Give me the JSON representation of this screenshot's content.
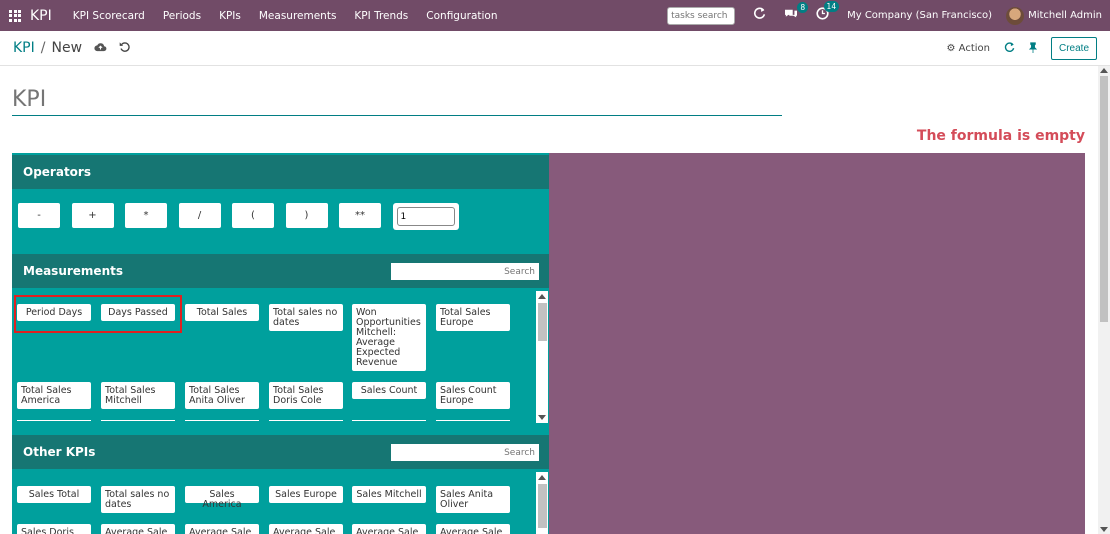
{
  "nav": {
    "brand": "KPI",
    "menu": [
      "KPI Scorecard",
      "Periods",
      "KPIs",
      "Measurements",
      "KPI Trends",
      "Configuration"
    ],
    "tasks_search_placeholder": "tasks search",
    "messages_count": "8",
    "activities_count": "14",
    "company": "My Company (San Francisco)",
    "user": "Mitchell Admin"
  },
  "control": {
    "breadcrumb_parent": "KPI",
    "breadcrumb_sep": "/",
    "breadcrumb_current": "New",
    "action_label": "Action",
    "create_label": "Create"
  },
  "form": {
    "name_placeholder": "KPI",
    "formula_error": "The formula is empty"
  },
  "operators": {
    "title": "Operators",
    "buttons": [
      "-",
      "+",
      "*",
      "/",
      "(",
      ")",
      "**"
    ],
    "number_value": "1"
  },
  "measurements": {
    "title": "Measurements",
    "search_placeholder": "Search",
    "items": [
      "Period Days",
      "Days Passed",
      "Total Sales",
      "Total sales no dates",
      "Won Opportunities Mitchell: Average Expected Revenue",
      "Total Sales Europe",
      "Total Sales America",
      "Total Sales Mitchell",
      "Total Sales Anita Oliver",
      "Total Sales Doris Cole",
      "Sales Count",
      "Sales Count Europe"
    ]
  },
  "other_kpis": {
    "title": "Other KPIs",
    "search_placeholder": "Search",
    "items": [
      "Sales Total",
      "Total sales no dates",
      "Sales America",
      "Sales Europe",
      "Sales Mitchell",
      "Sales Anita Oliver",
      "Sales Doris",
      "Average Sale",
      "Average Sale",
      "Average Sale",
      "Average Sale",
      "Average Sale"
    ]
  }
}
